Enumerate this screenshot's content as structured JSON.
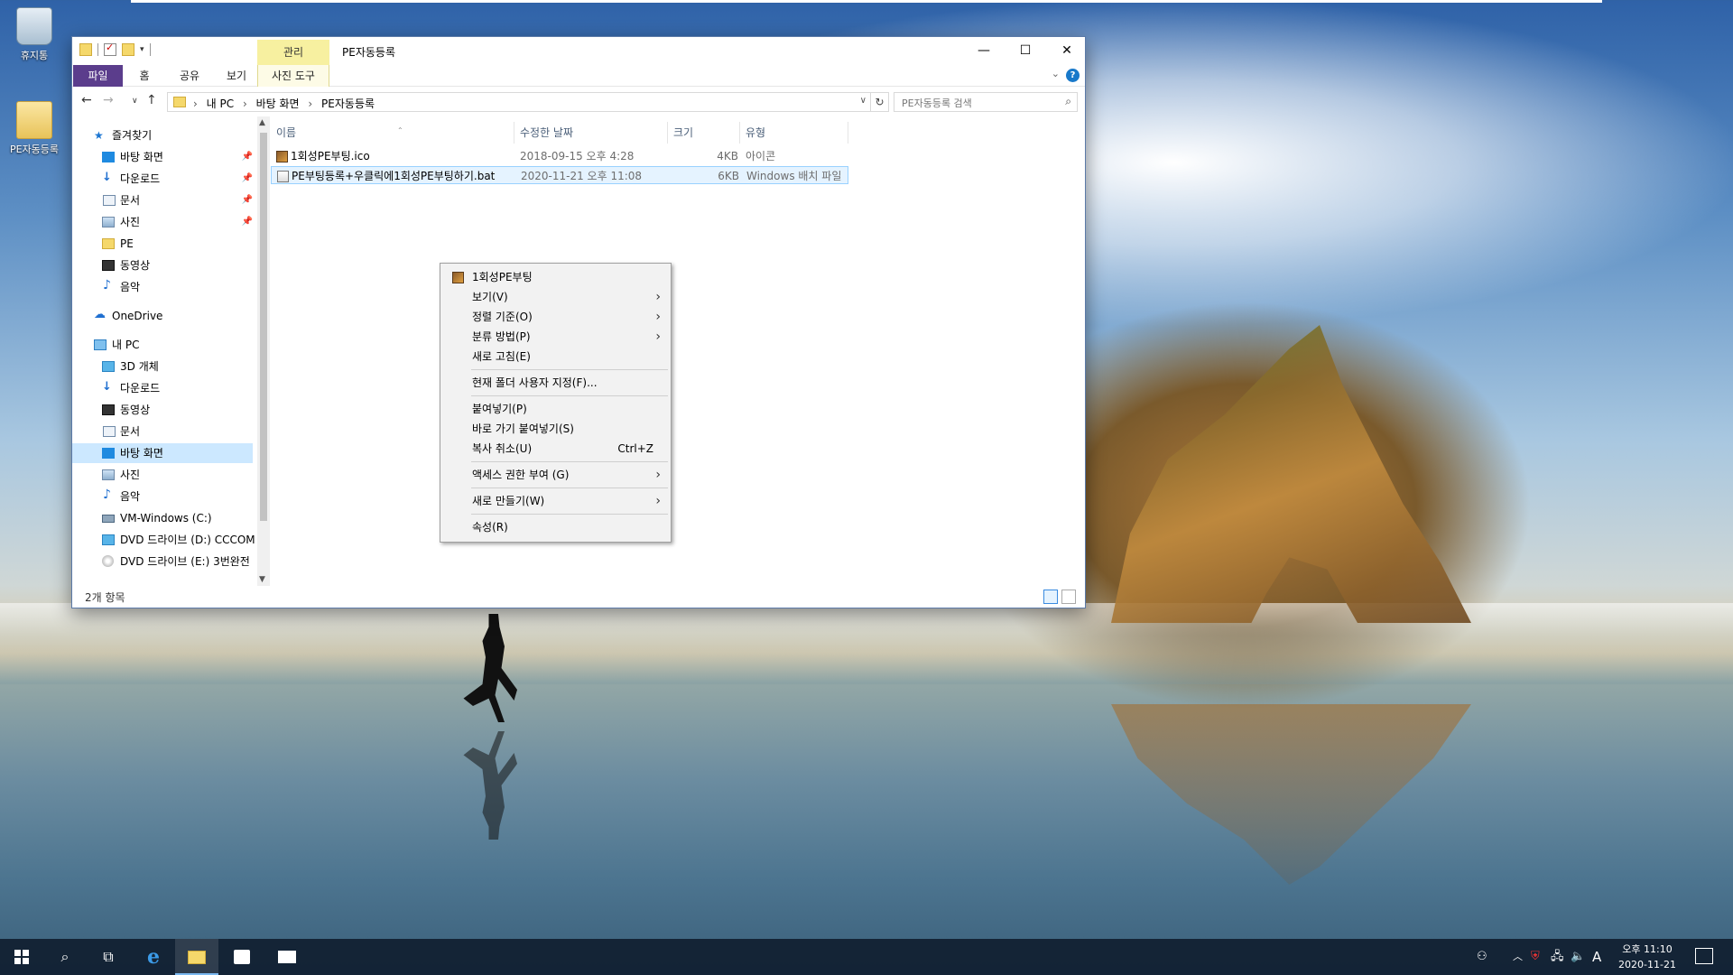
{
  "desktop": {
    "icons": [
      {
        "label": "휴지통",
        "icon": "recycle-bin-icon"
      },
      {
        "label": "PE자동등록",
        "icon": "folder-icon"
      }
    ]
  },
  "window": {
    "title": "PE자동등록",
    "manage_tab": "관리",
    "controls": {
      "minimize": "—",
      "maximize": "☐",
      "close": "✕"
    },
    "ribbon_tabs": [
      "파일",
      "홈",
      "공유",
      "보기",
      "사진 도구"
    ],
    "help": "?",
    "address": {
      "crumbs": [
        "내 PC",
        "바탕 화면",
        "PE자동등록"
      ]
    },
    "search_placeholder": "PE자동등록 검색",
    "nav": {
      "quick_access": "즐겨찾기",
      "quick_items": [
        "바탕 화면",
        "다운로드",
        "문서",
        "사진",
        "PE",
        "동영상",
        "음악"
      ],
      "onedrive": "OneDrive",
      "this_pc": "내 PC",
      "pc_items": [
        "3D 개체",
        "다운로드",
        "동영상",
        "문서",
        "바탕 화면",
        "사진",
        "음악",
        "VM-Windows (C:)",
        "DVD 드라이브 (D:) CCCOM",
        "DVD 드라이브 (E:) 3번완전"
      ]
    },
    "columns": [
      "이름",
      "수정한 날짜",
      "크기",
      "유형"
    ],
    "files": [
      {
        "name": "1회성PE부팅.ico",
        "date": "2018-09-15 오후 4:28",
        "size": "4KB",
        "type": "아이콘"
      },
      {
        "name": "PE부팅등록+우클릭에1회성PE부팅하기.bat",
        "date": "2020-11-21 오후 11:08",
        "size": "6KB",
        "type": "Windows 배치 파일"
      }
    ],
    "status": "2개 항목"
  },
  "context_menu": {
    "items": [
      {
        "label": "1회성PE부팅",
        "shortcut": "",
        "submenu": false,
        "icon": true
      },
      {
        "label": "보기(V)",
        "shortcut": "",
        "submenu": true
      },
      {
        "label": "정렬 기준(O)",
        "shortcut": "",
        "submenu": true
      },
      {
        "label": "분류 방법(P)",
        "shortcut": "",
        "submenu": true
      },
      {
        "label": "새로 고침(E)",
        "shortcut": "",
        "submenu": false
      },
      {
        "label": "현재 폴더 사용자 지정(F)...",
        "shortcut": "",
        "submenu": false
      },
      {
        "label": "붙여넣기(P)",
        "shortcut": "",
        "submenu": false
      },
      {
        "label": "바로 가기 붙여넣기(S)",
        "shortcut": "",
        "submenu": false
      },
      {
        "label": "복사 취소(U)",
        "shortcut": "Ctrl+Z",
        "submenu": false
      },
      {
        "label": "액세스 권한 부여 (G)",
        "shortcut": "",
        "submenu": true
      },
      {
        "label": "새로 만들기(W)",
        "shortcut": "",
        "submenu": true
      },
      {
        "label": "속성(R)",
        "shortcut": "",
        "submenu": false
      }
    ]
  },
  "taskbar": {
    "clock_time": "오후 11:10",
    "clock_date": "2020-11-21",
    "ime": "A"
  }
}
